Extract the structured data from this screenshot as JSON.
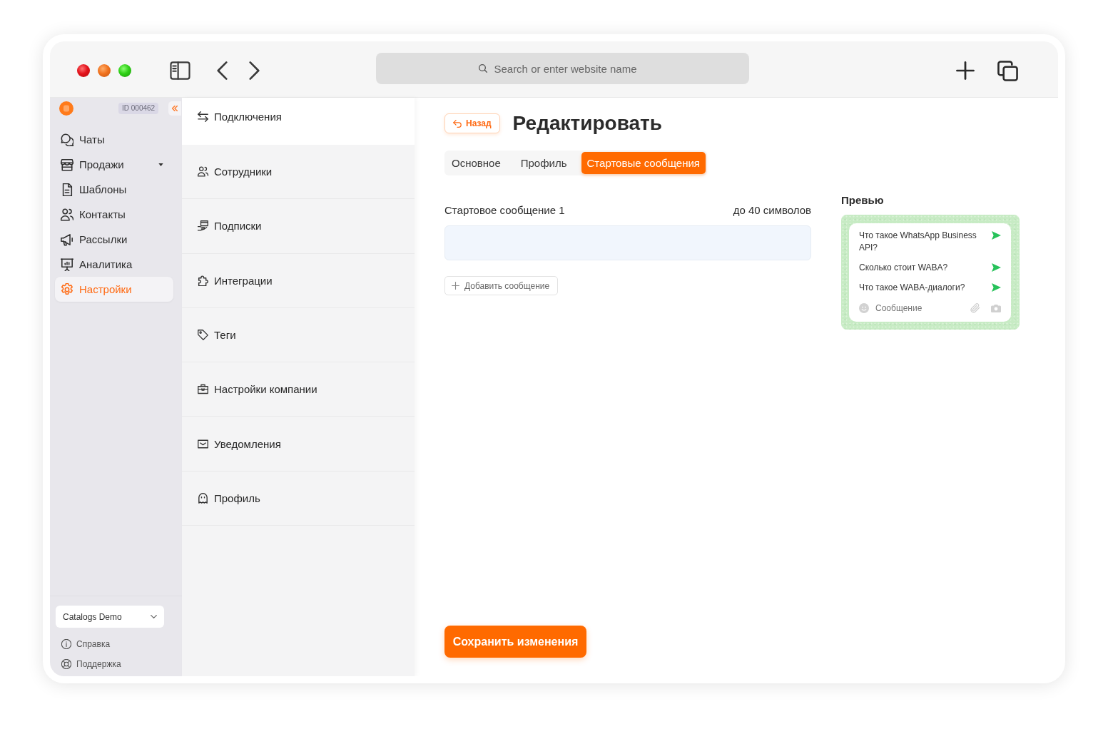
{
  "browser": {
    "address_bar": {
      "placeholder": "Search or enter website name"
    }
  },
  "sidebar": {
    "account_id": "ID 000462",
    "items": [
      {
        "label": "Чаты",
        "selected": false,
        "expandable": false
      },
      {
        "label": "Продажи",
        "selected": false,
        "expandable": true
      },
      {
        "label": "Шаблоны",
        "selected": false,
        "expandable": false
      },
      {
        "label": "Контакты",
        "selected": false,
        "expandable": false
      },
      {
        "label": "Рассылки",
        "selected": false,
        "expandable": false
      },
      {
        "label": "Аналитика",
        "selected": false,
        "expandable": false
      },
      {
        "label": "Настройки",
        "selected": true,
        "expandable": false
      }
    ],
    "workspace_select": {
      "value": "Catalogs Demo"
    },
    "footer_links": [
      "Справка",
      "Поддержка"
    ]
  },
  "settings_menu": {
    "items": [
      {
        "label": "Подключения",
        "selected": true
      },
      {
        "label": "Сотрудники",
        "selected": false
      },
      {
        "label": "Подписки",
        "selected": false
      },
      {
        "label": "Интеграции",
        "selected": false
      },
      {
        "label": "Теги",
        "selected": false
      },
      {
        "label": "Настройки компании",
        "selected": false
      },
      {
        "label": "Уведомления",
        "selected": false
      },
      {
        "label": "Профиль",
        "selected": false
      }
    ]
  },
  "editor": {
    "back_button": "Назад",
    "title": "Редактировать",
    "tabs": [
      {
        "label": "Основное",
        "selected": false
      },
      {
        "label": "Профиль",
        "selected": false
      },
      {
        "label": "Стартовые сообщения",
        "selected": true
      }
    ],
    "fields": [
      {
        "label": "Стартовое сообщение 1",
        "hint": "до 40 символов"
      }
    ],
    "add_button": "Добавить сообщение",
    "preview": {
      "title": "Превью",
      "messages": [
        "Что такое WhatsApp Business API?",
        "Сколько стоит WABA?",
        "Что такое WABA-диалоги?"
      ],
      "composer": {
        "placeholder": "Сообщение"
      }
    },
    "save_button": "Сохранить изменения"
  }
}
